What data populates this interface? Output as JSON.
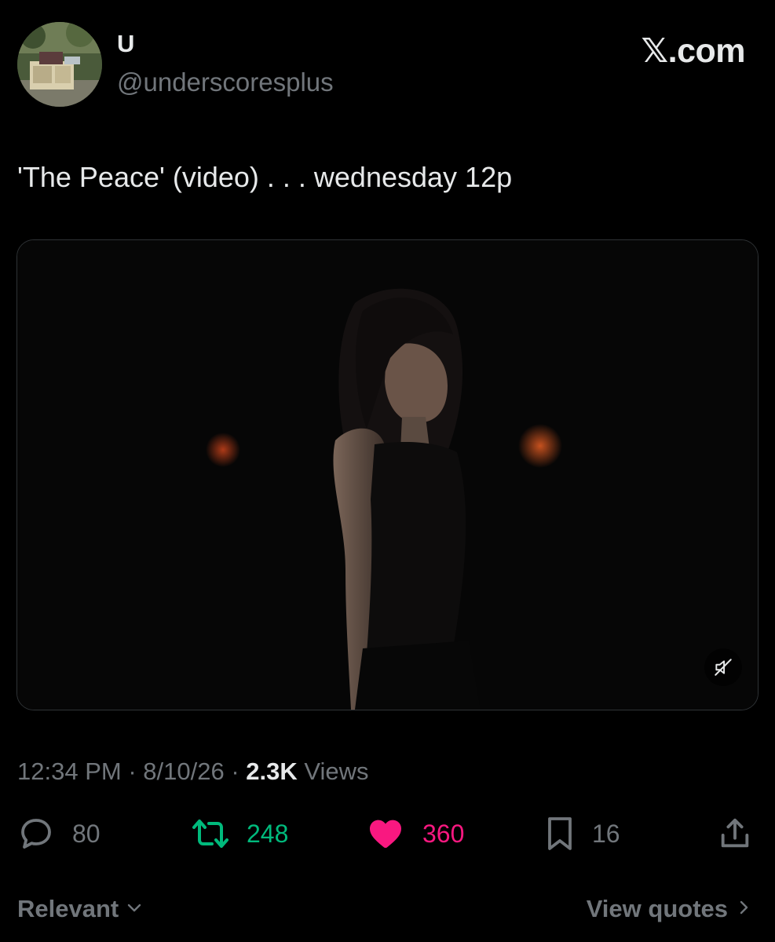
{
  "author": {
    "display_name": "U",
    "handle": "@underscoresplus"
  },
  "site_badge": "𝕏.com",
  "tweet": {
    "text": "'The Peace' (video) . . . wednesday 12p"
  },
  "media": {
    "mute_icon": "speaker-muted-icon"
  },
  "meta": {
    "time": "12:34 PM",
    "separator": "·",
    "date": "8/10/26",
    "views_count": "2.3K",
    "views_label": "Views"
  },
  "actions": {
    "replies": "80",
    "retweets": "248",
    "likes": "360",
    "bookmarks": "16"
  },
  "footer": {
    "sort_label": "Relevant",
    "view_quotes_label": "View quotes"
  },
  "colors": {
    "background": "#000000",
    "primary_text": "#e7e9ea",
    "secondary_text": "#71767b",
    "retweet_green": "#00ba7c",
    "like_pink": "#f91880",
    "media_border": "#2f3336"
  }
}
